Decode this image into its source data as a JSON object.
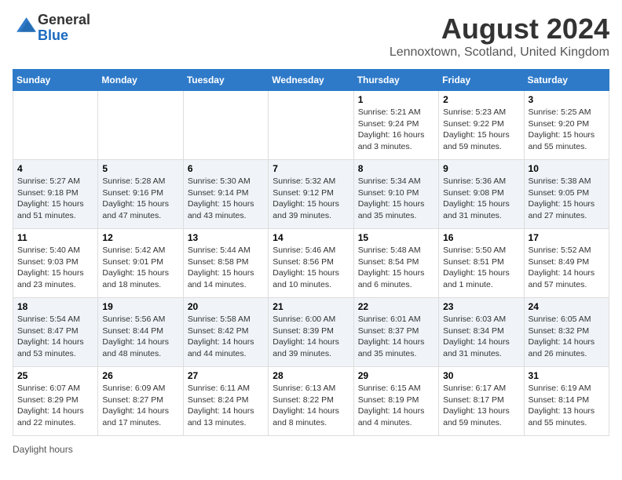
{
  "logo": {
    "general": "General",
    "blue": "Blue"
  },
  "title": "August 2024",
  "subtitle": "Lennoxtown, Scotland, United Kingdom",
  "days_of_week": [
    "Sunday",
    "Monday",
    "Tuesday",
    "Wednesday",
    "Thursday",
    "Friday",
    "Saturday"
  ],
  "legend": "Daylight hours",
  "weeks": [
    [
      {
        "day": "",
        "info": ""
      },
      {
        "day": "",
        "info": ""
      },
      {
        "day": "",
        "info": ""
      },
      {
        "day": "",
        "info": ""
      },
      {
        "day": "1",
        "info": "Sunrise: 5:21 AM\nSunset: 9:24 PM\nDaylight: 16 hours and 3 minutes."
      },
      {
        "day": "2",
        "info": "Sunrise: 5:23 AM\nSunset: 9:22 PM\nDaylight: 15 hours and 59 minutes."
      },
      {
        "day": "3",
        "info": "Sunrise: 5:25 AM\nSunset: 9:20 PM\nDaylight: 15 hours and 55 minutes."
      }
    ],
    [
      {
        "day": "4",
        "info": "Sunrise: 5:27 AM\nSunset: 9:18 PM\nDaylight: 15 hours and 51 minutes."
      },
      {
        "day": "5",
        "info": "Sunrise: 5:28 AM\nSunset: 9:16 PM\nDaylight: 15 hours and 47 minutes."
      },
      {
        "day": "6",
        "info": "Sunrise: 5:30 AM\nSunset: 9:14 PM\nDaylight: 15 hours and 43 minutes."
      },
      {
        "day": "7",
        "info": "Sunrise: 5:32 AM\nSunset: 9:12 PM\nDaylight: 15 hours and 39 minutes."
      },
      {
        "day": "8",
        "info": "Sunrise: 5:34 AM\nSunset: 9:10 PM\nDaylight: 15 hours and 35 minutes."
      },
      {
        "day": "9",
        "info": "Sunrise: 5:36 AM\nSunset: 9:08 PM\nDaylight: 15 hours and 31 minutes."
      },
      {
        "day": "10",
        "info": "Sunrise: 5:38 AM\nSunset: 9:05 PM\nDaylight: 15 hours and 27 minutes."
      }
    ],
    [
      {
        "day": "11",
        "info": "Sunrise: 5:40 AM\nSunset: 9:03 PM\nDaylight: 15 hours and 23 minutes."
      },
      {
        "day": "12",
        "info": "Sunrise: 5:42 AM\nSunset: 9:01 PM\nDaylight: 15 hours and 18 minutes."
      },
      {
        "day": "13",
        "info": "Sunrise: 5:44 AM\nSunset: 8:58 PM\nDaylight: 15 hours and 14 minutes."
      },
      {
        "day": "14",
        "info": "Sunrise: 5:46 AM\nSunset: 8:56 PM\nDaylight: 15 hours and 10 minutes."
      },
      {
        "day": "15",
        "info": "Sunrise: 5:48 AM\nSunset: 8:54 PM\nDaylight: 15 hours and 6 minutes."
      },
      {
        "day": "16",
        "info": "Sunrise: 5:50 AM\nSunset: 8:51 PM\nDaylight: 15 hours and 1 minute."
      },
      {
        "day": "17",
        "info": "Sunrise: 5:52 AM\nSunset: 8:49 PM\nDaylight: 14 hours and 57 minutes."
      }
    ],
    [
      {
        "day": "18",
        "info": "Sunrise: 5:54 AM\nSunset: 8:47 PM\nDaylight: 14 hours and 53 minutes."
      },
      {
        "day": "19",
        "info": "Sunrise: 5:56 AM\nSunset: 8:44 PM\nDaylight: 14 hours and 48 minutes."
      },
      {
        "day": "20",
        "info": "Sunrise: 5:58 AM\nSunset: 8:42 PM\nDaylight: 14 hours and 44 minutes."
      },
      {
        "day": "21",
        "info": "Sunrise: 6:00 AM\nSunset: 8:39 PM\nDaylight: 14 hours and 39 minutes."
      },
      {
        "day": "22",
        "info": "Sunrise: 6:01 AM\nSunset: 8:37 PM\nDaylight: 14 hours and 35 minutes."
      },
      {
        "day": "23",
        "info": "Sunrise: 6:03 AM\nSunset: 8:34 PM\nDaylight: 14 hours and 31 minutes."
      },
      {
        "day": "24",
        "info": "Sunrise: 6:05 AM\nSunset: 8:32 PM\nDaylight: 14 hours and 26 minutes."
      }
    ],
    [
      {
        "day": "25",
        "info": "Sunrise: 6:07 AM\nSunset: 8:29 PM\nDaylight: 14 hours and 22 minutes."
      },
      {
        "day": "26",
        "info": "Sunrise: 6:09 AM\nSunset: 8:27 PM\nDaylight: 14 hours and 17 minutes."
      },
      {
        "day": "27",
        "info": "Sunrise: 6:11 AM\nSunset: 8:24 PM\nDaylight: 14 hours and 13 minutes."
      },
      {
        "day": "28",
        "info": "Sunrise: 6:13 AM\nSunset: 8:22 PM\nDaylight: 14 hours and 8 minutes."
      },
      {
        "day": "29",
        "info": "Sunrise: 6:15 AM\nSunset: 8:19 PM\nDaylight: 14 hours and 4 minutes."
      },
      {
        "day": "30",
        "info": "Sunrise: 6:17 AM\nSunset: 8:17 PM\nDaylight: 13 hours and 59 minutes."
      },
      {
        "day": "31",
        "info": "Sunrise: 6:19 AM\nSunset: 8:14 PM\nDaylight: 13 hours and 55 minutes."
      }
    ]
  ]
}
